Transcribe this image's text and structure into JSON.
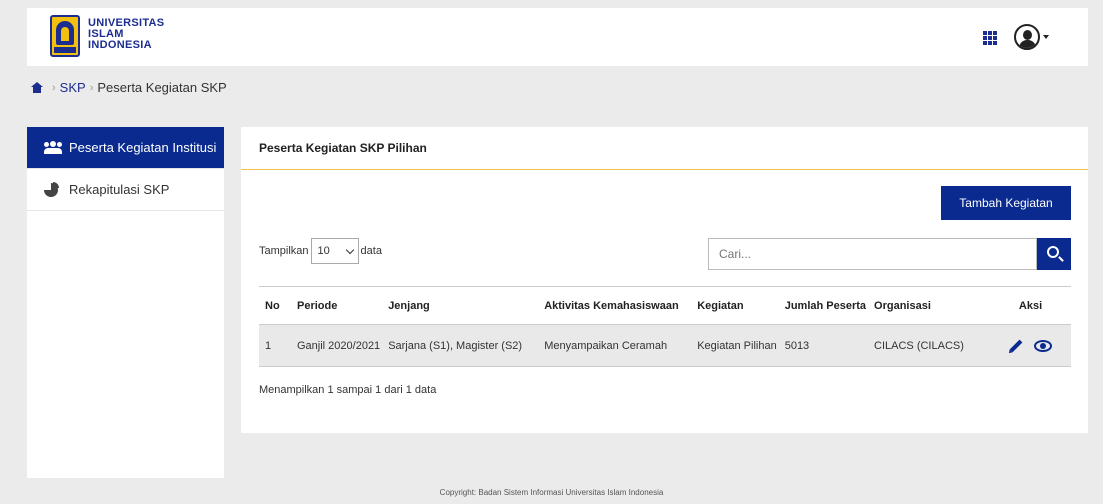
{
  "header": {
    "logo_lines": [
      "UNIVERSITAS",
      "ISLAM",
      "INDONESIA"
    ]
  },
  "breadcrumb": {
    "items": [
      "SKP",
      "Peserta Kegiatan SKP"
    ]
  },
  "sidebar": {
    "items": [
      {
        "label": "Peserta Kegiatan Institusi",
        "icon": "users-icon",
        "active": true
      },
      {
        "label": "Rekapitulasi SKP",
        "icon": "pie-chart-icon",
        "active": false
      }
    ]
  },
  "panel": {
    "title": "Peserta Kegiatan SKP Pilihan",
    "add_button": "Tambah Kegiatan",
    "length": {
      "prefix": "Tampilkan",
      "value": "10",
      "suffix": "data"
    },
    "search": {
      "placeholder": "Cari..."
    },
    "table": {
      "columns": [
        "No",
        "Periode",
        "Jenjang",
        "Aktivitas Kemahasiswaan",
        "Kegiatan",
        "Jumlah Peserta",
        "Organisasi",
        "Aksi"
      ],
      "rows": [
        [
          "1",
          "Ganjil 2020/2021",
          "Sarjana (S1), Magister (S2)",
          "Menyampaikan Ceramah",
          "Kegiatan Pilihan",
          "5013",
          "CILACS (CILACS)"
        ]
      ]
    },
    "info": "Menampilkan 1 sampai 1 dari 1 data"
  },
  "footer": {
    "copyright": "Copyright: Badan Sistem Informasi Universitas Islam Indonesia"
  },
  "colors": {
    "primary": "#0a2a8f",
    "accent_line": "#f0c040",
    "background": "#ebebeb"
  }
}
